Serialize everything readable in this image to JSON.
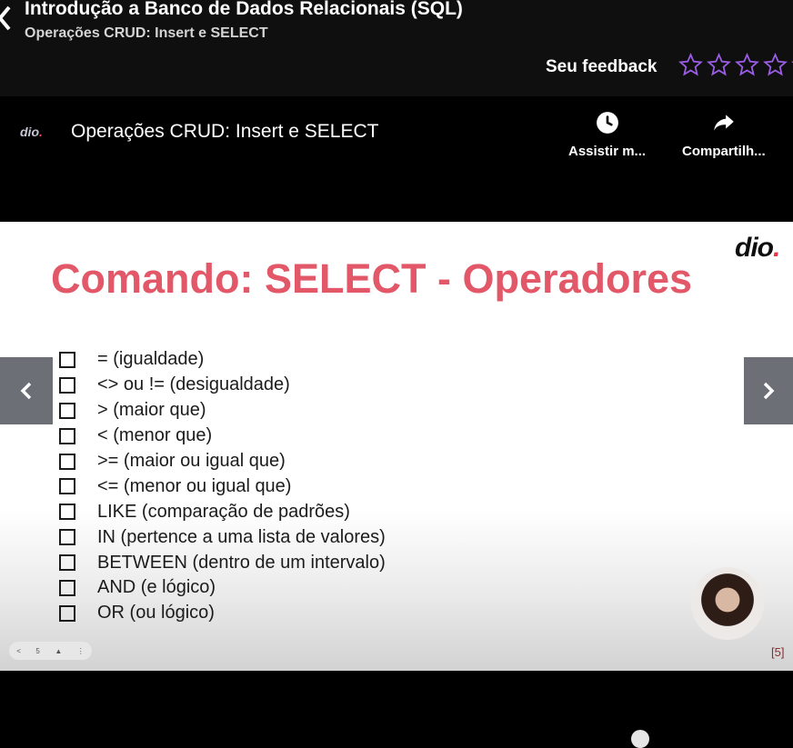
{
  "header": {
    "course_title": "Introdução a Banco de Dados Relacionais (SQL)",
    "lesson_subtitle": "Operações CRUD: Insert e SELECT",
    "feedback_label": "Seu feedback",
    "rating": 0,
    "star_color": "#9b5de5"
  },
  "player": {
    "logo_text": "dio",
    "title": "Operações CRUD: Insert e SELECT",
    "actions": [
      {
        "label": "Assistir m...",
        "icon": "clock-icon"
      },
      {
        "label": "Compartilh...",
        "icon": "share-icon"
      }
    ]
  },
  "slide": {
    "logo_text": "dio",
    "title": "Comando: SELECT - Operadores",
    "title_color": "#e25868",
    "items": [
      "= (igualdade)",
      "<> ou != (desigualdade)",
      "> (maior que)",
      "< (menor que)",
      ">= (maior ou igual que)",
      "<= (menor ou igual que)",
      "LIKE (comparação de padrões)",
      "IN (pertence a uma lista de valores)",
      "BETWEEN (dentro de um intervalo)",
      "AND (e lógico)",
      "OR (ou lógico)"
    ],
    "controls": [
      "<",
      "5"
    ],
    "page_number": "[5]"
  }
}
